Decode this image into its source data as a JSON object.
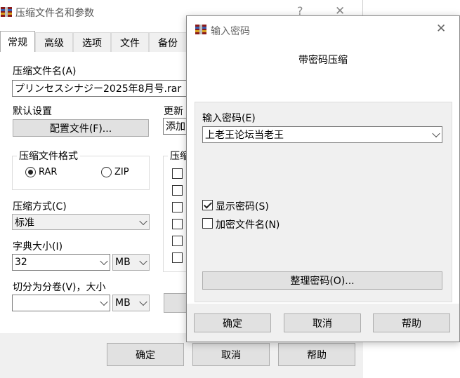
{
  "main_window": {
    "title": "压缩文件名和参数",
    "help_glyph": "?",
    "close_glyph": "✕",
    "tabs": [
      "常规",
      "高级",
      "选项",
      "文件",
      "备份"
    ],
    "archive_name_label": "压缩文件名(A)",
    "archive_name_value": "プリンセスシナジー2025年8月号.rar",
    "default_settings_label": "默认设置",
    "profiles_button": "配置文件(F)...",
    "update_mode_label": "更新",
    "update_mode_value": "添加",
    "format_group_label": "压缩文件格式",
    "format_rar": "RAR",
    "format_zip": "ZIP",
    "selected_format": "RAR",
    "options_group_label": "压缩",
    "method_label": "压缩方式(C)",
    "method_value": "标准",
    "dict_label": "字典大小(I)",
    "dict_value": "32",
    "dict_unit": "MB",
    "split_label": "切分为分卷(V)，大小",
    "split_value": "",
    "split_unit": "MB",
    "ok_button": "确定",
    "cancel_button": "取消",
    "help_button": "帮助"
  },
  "password_dialog": {
    "title": "输入密码",
    "close_glyph": "✕",
    "heading": "带密码压缩",
    "password_label": "输入密码(E)",
    "password_value": "上老王论坛当老王",
    "show_password_label": "显示密码(S)",
    "show_password_checked": true,
    "encrypt_names_label": "加密文件名(N)",
    "encrypt_names_checked": false,
    "organize_button": "整理密码(O)...",
    "ok_button": "确定",
    "cancel_button": "取消",
    "help_button": "帮助"
  },
  "colors": {
    "button_bg": "#e1e1e1",
    "button_border": "#adadad",
    "dialog_body_bg": "#f0f0f0",
    "dialog_bottom_bg": "#f0f0f0"
  },
  "icons": [
    "winrar-app-icon",
    "help-icon",
    "close-icon",
    "chevron-down-icon"
  ]
}
